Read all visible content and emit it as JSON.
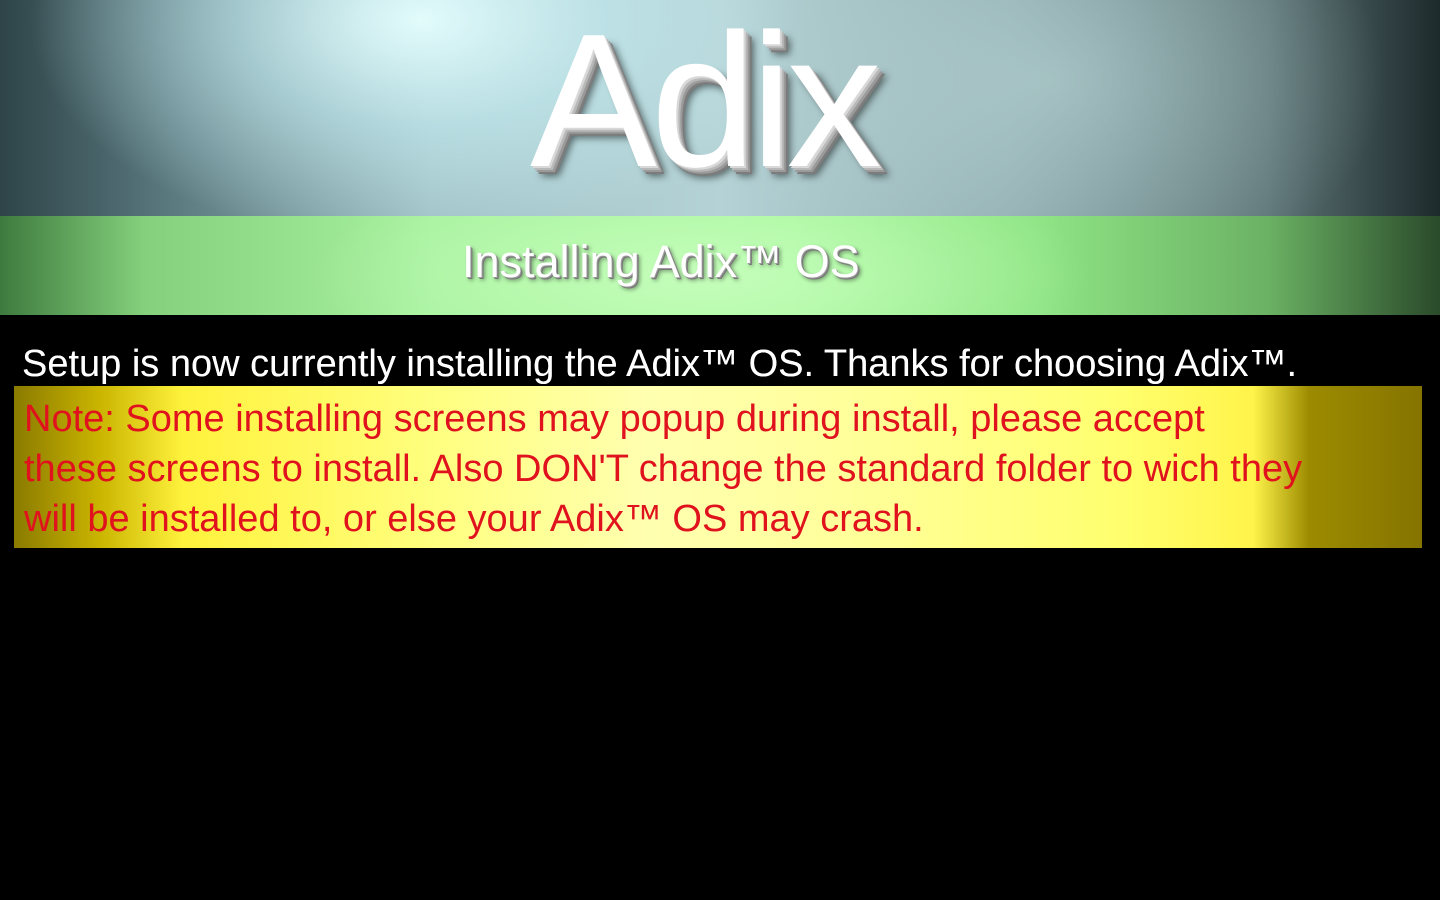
{
  "header": {
    "logo_text": "Adix",
    "subtitle": "Installing Adix™ OS"
  },
  "main": {
    "status_message": "Setup is now currently installing the Adix™ OS. Thanks for choosing Adix™.",
    "note_lines": [
      "Note: Some installing screens may popup during install, please accept",
      "these screens to install. Also DON'T change the standard folder to wich they",
      "will be installed to, or else your Adix™ OS may crash."
    ]
  },
  "colors": {
    "background": "#000000",
    "banner": "#9fc0c4",
    "green_band": "#a8f29f",
    "note_background": "#ffff80",
    "note_text": "#e0121e",
    "status_text": "#ffffff"
  }
}
